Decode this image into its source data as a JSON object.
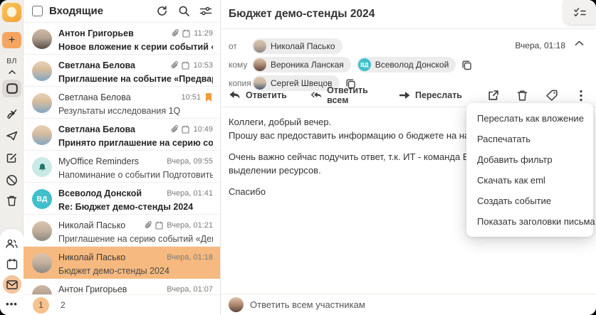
{
  "colors": {
    "accent_orange": "#F5A55F",
    "selected_row": "#F6B97F",
    "pagination_active": "#F7C28E",
    "teal_avatar": "#3FC0CA",
    "flag_orange": "#F09B3C",
    "sidebar_bg": "#F0EEEB",
    "selected_folder_bg": "#DCD9D6",
    "mail_icon_bg": "#F5C49C"
  },
  "sidebar": {
    "user_initials": "ВЛ",
    "icons": [
      "app-logo",
      "compose-plus",
      "collapse-up",
      "inbox",
      "redirect",
      "send",
      "compose",
      "spam",
      "trash",
      "contacts",
      "calendar",
      "mail",
      "more"
    ]
  },
  "mail_list": {
    "title": "Входящие",
    "header_icons": [
      "refresh",
      "search",
      "filter"
    ],
    "pagination": {
      "current": "1",
      "next": "2"
    },
    "emails": [
      {
        "sender": "Антон Григорьев",
        "subject": "Новое вложение к серии событий «Аналити…",
        "time": "11:29",
        "unread": true,
        "attachment": true,
        "event": true,
        "flagged": false,
        "selected": false,
        "avatar": "anton"
      },
      {
        "sender": "Светлана Белова",
        "subject": "Приглашение на событие «Предварительно…",
        "time": "10:53",
        "unread": true,
        "attachment": true,
        "event": true,
        "flagged": false,
        "selected": false,
        "avatar": "svetlana"
      },
      {
        "sender": "Светлана Белова",
        "subject": "Результаты исследования 1Q",
        "time": "10:51",
        "unread": false,
        "attachment": false,
        "event": false,
        "flagged": true,
        "selected": false,
        "avatar": "svetlana"
      },
      {
        "sender": "Светлана Белова",
        "subject": "Принято приглашение на серию событий «…",
        "time": "10:49",
        "unread": true,
        "attachment": true,
        "event": true,
        "flagged": false,
        "selected": false,
        "avatar": "svetlana"
      },
      {
        "sender": "MyOffice Reminders",
        "subject": "Напоминание о событии Подготовить отчет…",
        "time": "Вчера, 09:55",
        "unread": false,
        "attachment": false,
        "event": false,
        "flagged": false,
        "selected": false,
        "avatar": "reminders"
      },
      {
        "sender": "Всеволод Донской",
        "subject": "Re: Бюджет демо-стенды 2024",
        "time": "Вчера, 01:41",
        "unread": true,
        "attachment": false,
        "event": false,
        "flagged": false,
        "selected": false,
        "avatar": "vd",
        "initials": "ВД"
      },
      {
        "sender": "Николай Пасько",
        "subject": "Приглашение на серию событий «Демо стен…",
        "time": "Вчера, 01:21",
        "unread": false,
        "attachment": true,
        "event": true,
        "flagged": false,
        "selected": false,
        "avatar": "nikolay"
      },
      {
        "sender": "Николай Пасько",
        "subject": "Бюджет демо-стенды 2024",
        "time": "Вчера, 01:18",
        "unread": false,
        "attachment": false,
        "event": false,
        "flagged": false,
        "selected": true,
        "avatar": "nikolay"
      },
      {
        "sender": "Антон Григорьев",
        "subject": "",
        "time": "Вчера, 01:07",
        "unread": false,
        "attachment": false,
        "event": false,
        "flagged": false,
        "selected": false,
        "avatar": "anton"
      }
    ]
  },
  "message": {
    "subject": "Бюджет демо-стенды 2024",
    "date": "Вчера, 01:18",
    "from_label": "от",
    "to_label": "кому",
    "cc_label": "копия",
    "from": [
      {
        "name": "Николай Пасько",
        "avatar": "nikolay"
      }
    ],
    "to": [
      {
        "name": "Вероника Ланская",
        "avatar": "veronika"
      },
      {
        "name": "Всеволод Донской",
        "avatar": "vd",
        "initials": "ВД"
      }
    ],
    "cc": [
      {
        "name": "Сергей Швецов",
        "avatar": "sergey"
      }
    ],
    "actions": {
      "reply": "Ответить",
      "reply_all": "Ответить всем",
      "forward": "Переслать"
    },
    "body_lines": [
      "Коллеги, добрый вечер.",
      "Прошу вас предоставить информацию о бюджете на наши демонстраци",
      "",
      "Очень важно сейчас подучить ответ, т.к. ИТ - команда Всеволода, уже",
      "выделении ресурсов.",
      "",
      "Спасибо"
    ],
    "reply_placeholder": "Ответить всем участникам"
  },
  "context_menu": {
    "items": [
      "Переслать как вложение",
      "Распечатать",
      "Добавить фильтр",
      "Скачать как eml",
      "Создать событие",
      "Показать заголовки письма"
    ]
  }
}
